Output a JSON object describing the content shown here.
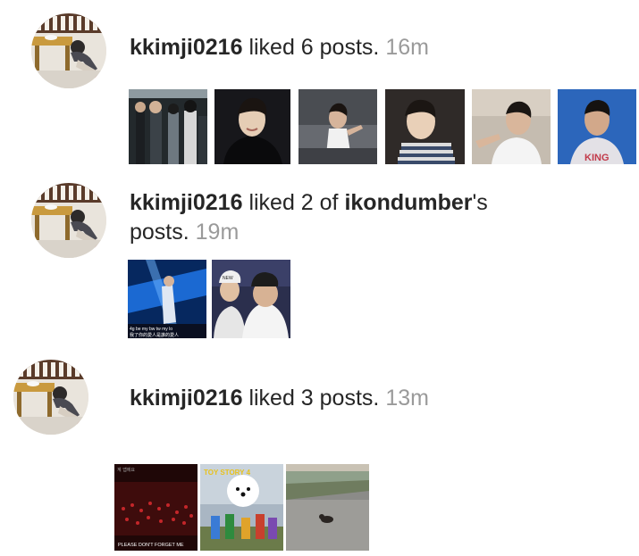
{
  "activities": [
    {
      "username": "kkimji0216",
      "action": " liked 6 posts.",
      "time": "16m",
      "thumbnails": [
        {
          "icon": "concert-group-photo",
          "bg": "#2a3336"
        },
        {
          "icon": "person-smiling-photo",
          "bg": "#1d1d22"
        },
        {
          "icon": "stage-performance-photo",
          "bg": "#5b5f66"
        },
        {
          "icon": "selfie-stripes-photo",
          "bg": "#3a3230"
        },
        {
          "icon": "person-pointing-photo",
          "bg": "#b8aea3"
        },
        {
          "icon": "person-blue-background-photo",
          "bg": "#2b64b8"
        }
      ]
    },
    {
      "username": "kkimji0216",
      "action_prefix": " liked 2 of ",
      "target_user": "ikondumber",
      "action_suffix": "'s",
      "action_line2": "posts.",
      "time": "19m",
      "thumbnails": [
        {
          "icon": "stage-blue-lights-photo",
          "bg": "#0a3a8c",
          "caption": "4g be my bw tw my lo",
          "caption2": "我了你的愛人是誰的愛人"
        },
        {
          "icon": "two-friends-hats-photo",
          "bg": "#2a2e4a"
        }
      ]
    },
    {
      "username": "kkimji0216",
      "action": " liked 3 posts.",
      "time": "13m",
      "thumbnails": [
        {
          "icon": "dark-crowd-photo",
          "bg": "#2b0b0b",
          "caption": "PLEASE DON'T FORGET ME",
          "caption_top": "계 앱에요"
        },
        {
          "icon": "toy-story-dog-photo",
          "bg": "#9aa8b6",
          "caption": "TOY STORY 4"
        },
        {
          "icon": "cat-on-road-photo",
          "bg": "#8d8d8a"
        }
      ]
    }
  ]
}
